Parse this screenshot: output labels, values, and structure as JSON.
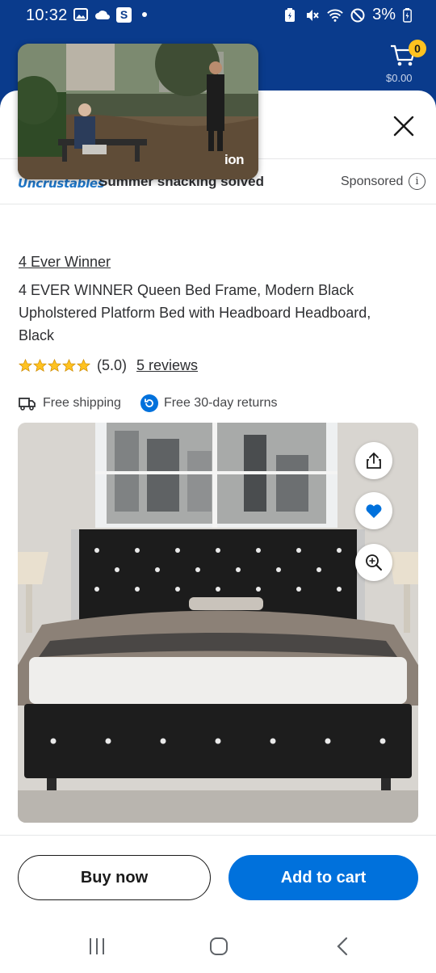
{
  "status_bar": {
    "time": "10:32",
    "battery": "3%",
    "icons": [
      "gallery-icon",
      "cloud-icon",
      "s-app-icon",
      "dot-icon",
      "battery-saver-icon",
      "mute-icon",
      "wifi-icon",
      "no-disturb-icon",
      "battery-icon"
    ]
  },
  "header": {
    "cart_count": "0",
    "cart_total": "$0.00",
    "accent": "#0a3b8c",
    "badge_color": "#ffc220"
  },
  "video": {
    "channel_logo": "ion"
  },
  "ad": {
    "brand_logo": "Uncrustables",
    "headline": "Summer snacking solved",
    "sponsored_label": "Sponsored",
    "info_glyph": "i"
  },
  "product": {
    "brand": "4 Ever Winner",
    "title": "4 EVER WINNER Queen Bed Frame, Modern Black Upholstered Platform Bed with Headboard Headboard, Black",
    "rating": 5.0,
    "rating_text": "(5.0)",
    "reviews_link": "5 reviews",
    "free_shipping": "Free shipping",
    "free_returns": "Free 30-day returns",
    "star_color": "#ffc220"
  },
  "actions": {
    "buy_now": "Buy now",
    "add_to_cart": "Add to cart",
    "primary_color": "#0071dc"
  },
  "image_buttons": [
    "share-icon",
    "heart-icon",
    "zoom-icon"
  ],
  "nav": [
    "recent-apps-icon",
    "home-icon",
    "back-icon"
  ]
}
